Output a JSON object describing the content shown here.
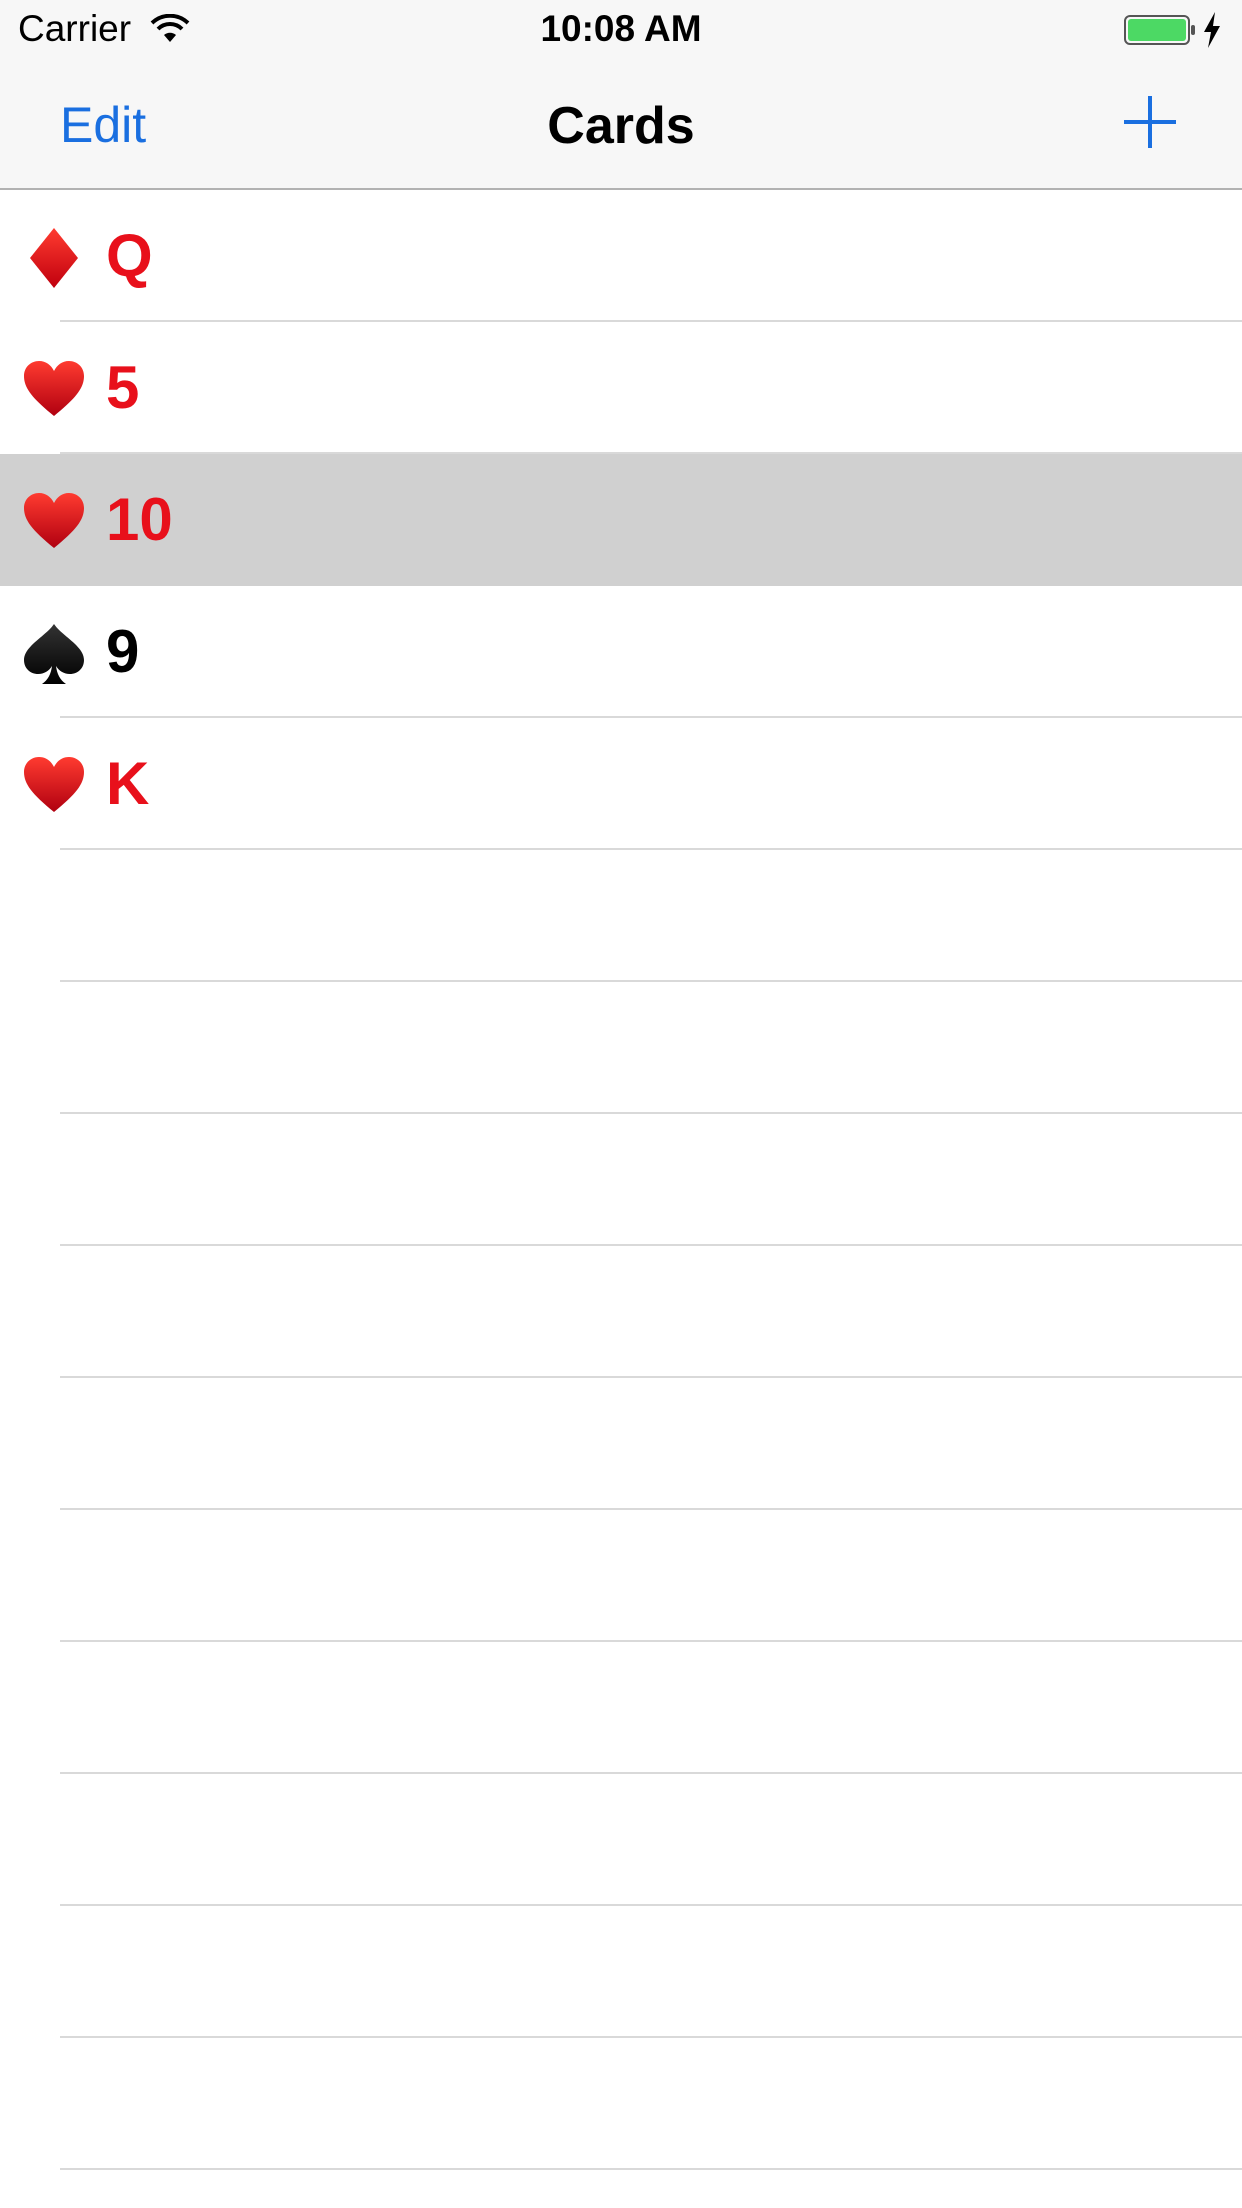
{
  "status_bar": {
    "carrier": "Carrier",
    "time": "10:08 AM",
    "icons": [
      "wifi-icon",
      "battery-icon",
      "charging-bolt-icon"
    ]
  },
  "nav": {
    "edit_label": "Edit",
    "title": "Cards",
    "add_icon": "plus-icon"
  },
  "colors": {
    "tint": "#1a6fe0",
    "red_suit": "#e8101b",
    "black_suit": "#000000",
    "selected_row": "#d0d0d0",
    "battery": "#4cd964"
  },
  "cards": [
    {
      "suit": "diamond",
      "rank": "Q",
      "color": "red",
      "selected": false
    },
    {
      "suit": "heart",
      "rank": "5",
      "color": "red",
      "selected": false
    },
    {
      "suit": "heart",
      "rank": "10",
      "color": "red",
      "selected": true
    },
    {
      "suit": "spade",
      "rank": "9",
      "color": "black",
      "selected": false
    },
    {
      "suit": "heart",
      "rank": "K",
      "color": "red",
      "selected": false
    }
  ]
}
